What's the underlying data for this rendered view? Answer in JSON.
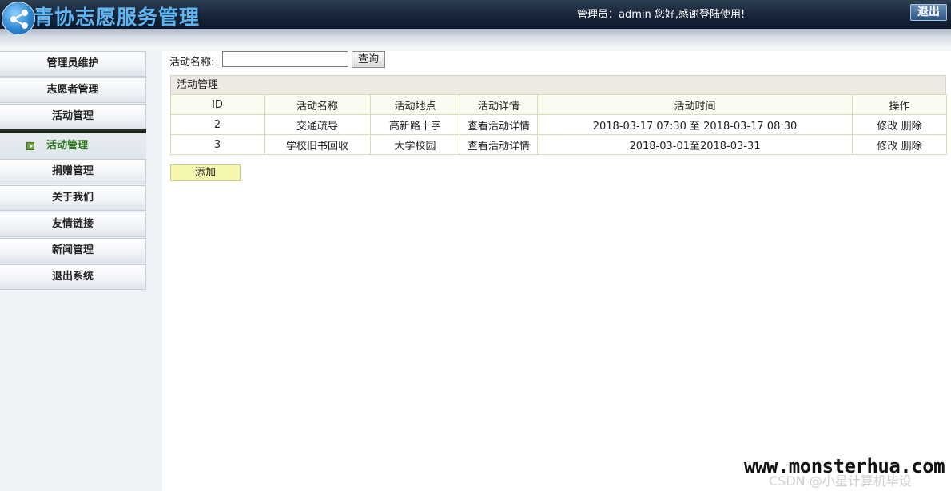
{
  "header": {
    "app_title": "青协志愿服务管理",
    "admin_greeting": "管理员：admin 您好,感谢登陆使用!",
    "logout_label": "退出"
  },
  "sidebar": {
    "items": [
      {
        "label": "管理员维护"
      },
      {
        "label": "志愿者管理"
      },
      {
        "label": "活动管理"
      },
      {
        "label": "活动管理",
        "active": true
      },
      {
        "label": "捐赠管理"
      },
      {
        "label": "关于我们"
      },
      {
        "label": "友情链接"
      },
      {
        "label": "新闻管理"
      },
      {
        "label": "退出系统"
      }
    ]
  },
  "search": {
    "label": "活动名称:",
    "value": "",
    "button_label": "查询"
  },
  "table": {
    "caption": "活动管理",
    "columns": [
      "ID",
      "活动名称",
      "活动地点",
      "活动详情",
      "活动时间",
      "操作"
    ],
    "rows": [
      {
        "id": "2",
        "name": "交通疏导",
        "location": "高新路十字",
        "detail": "查看活动详情",
        "time": "2018-03-17 07:30 至 2018-03-17 08:30",
        "edit": "修改",
        "delete": "删除"
      },
      {
        "id": "3",
        "name": "学校旧书回收",
        "location": "大学校园",
        "detail": "查看活动详情",
        "time": "2018-03-01至2018-03-31",
        "edit": "修改",
        "delete": "删除"
      }
    ]
  },
  "add_button_label": "添加",
  "watermark": {
    "site": "www.monsterhua.com",
    "credit": "CSDN @小星计算机毕设"
  },
  "colors": {
    "header_bg": "#17253a",
    "title_blue": "#5fb6f2",
    "active_menu_green": "#2f7a1c",
    "add_button_bg": "#f6f7ae",
    "table_border": "#d9ddb5"
  }
}
